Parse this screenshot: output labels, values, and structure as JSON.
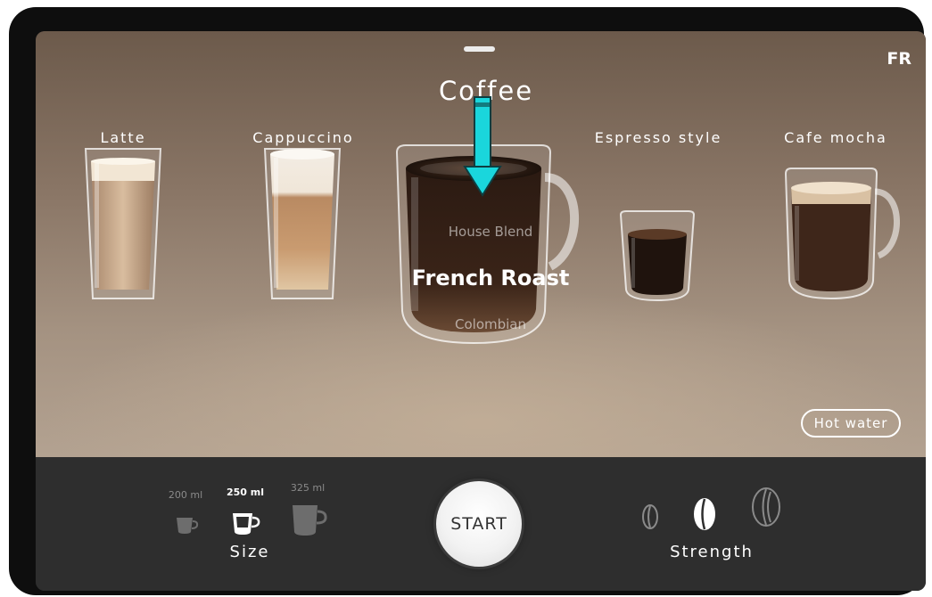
{
  "header": {
    "lang_label": "FR",
    "category_title": "Coffee"
  },
  "drinks": [
    {
      "label": "Latte"
    },
    {
      "label": "Cappuccino"
    },
    {
      "label": "Espresso style"
    },
    {
      "label": "Cafe mocha"
    }
  ],
  "blend_picker": {
    "previous": "House Blend",
    "selected": "French Roast",
    "next": "Colombian"
  },
  "hot_water_label": "Hot water",
  "size": {
    "title": "Size",
    "options": [
      {
        "label": "200 ml",
        "selected": false
      },
      {
        "label": "250 ml",
        "selected": true
      },
      {
        "label": "325 ml",
        "selected": false
      }
    ]
  },
  "start_label": "START",
  "strength": {
    "title": "Strength",
    "levels": [
      "low-strength-bean-icon",
      "medium-strength-bean-icon",
      "high-strength-bean-icon"
    ],
    "selected_index": 1
  },
  "colors": {
    "stage_top": "#6c5a4b",
    "stage_bottom": "#b3a291",
    "control_bar": "#2e2e2e",
    "annotation_arrow": "#1ad6dc"
  }
}
